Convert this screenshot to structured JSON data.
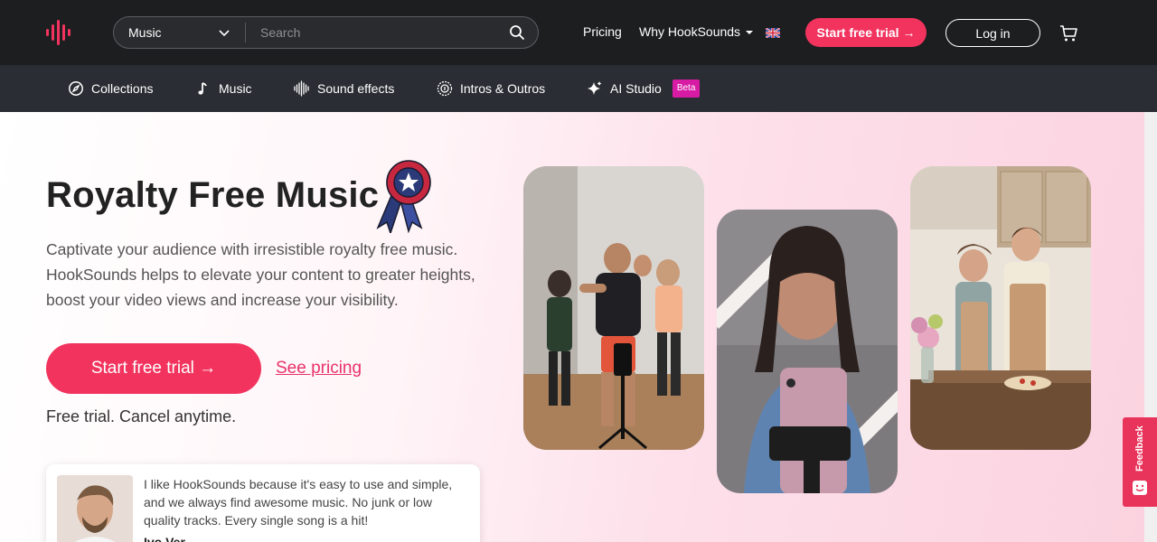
{
  "header": {
    "search": {
      "category": "Music",
      "placeholder": "Search"
    },
    "nav": {
      "pricing": "Pricing",
      "why": "Why HookSounds"
    },
    "trial_label": "Start free trial →",
    "login_label": "Log in"
  },
  "subnav": {
    "items": [
      {
        "label": "Collections",
        "icon": "compass-icon"
      },
      {
        "label": "Music",
        "icon": "music-note-icon"
      },
      {
        "label": "Sound effects",
        "icon": "waveform-icon"
      },
      {
        "label": "Intros & Outros",
        "icon": "badge-icon"
      },
      {
        "label": "AI Studio",
        "icon": "sparkle-icon"
      }
    ],
    "beta_badge": "Beta"
  },
  "hero": {
    "title": "Royalty Free Music",
    "description": "Captivate your audience with irresistible royalty free music. HookSounds helps to elevate your content to greater heights, boost your video views and increase your visibility.",
    "cta_label": "Start free trial →",
    "pricing_link": "See pricing",
    "note": "Free trial. Cancel anytime."
  },
  "testimonial": {
    "quote": "I like HookSounds because it's easy to use and simple, and we always find awesome music. No junk or low quality tracks. Every single song is a hit!",
    "name": "Ivo Ver..."
  },
  "feedback": {
    "label": "Feedback"
  },
  "colors": {
    "brand": "#f2335e",
    "topbar": "#1d1e20",
    "subnav": "#2a2d33",
    "beta": "#d81ba5"
  }
}
